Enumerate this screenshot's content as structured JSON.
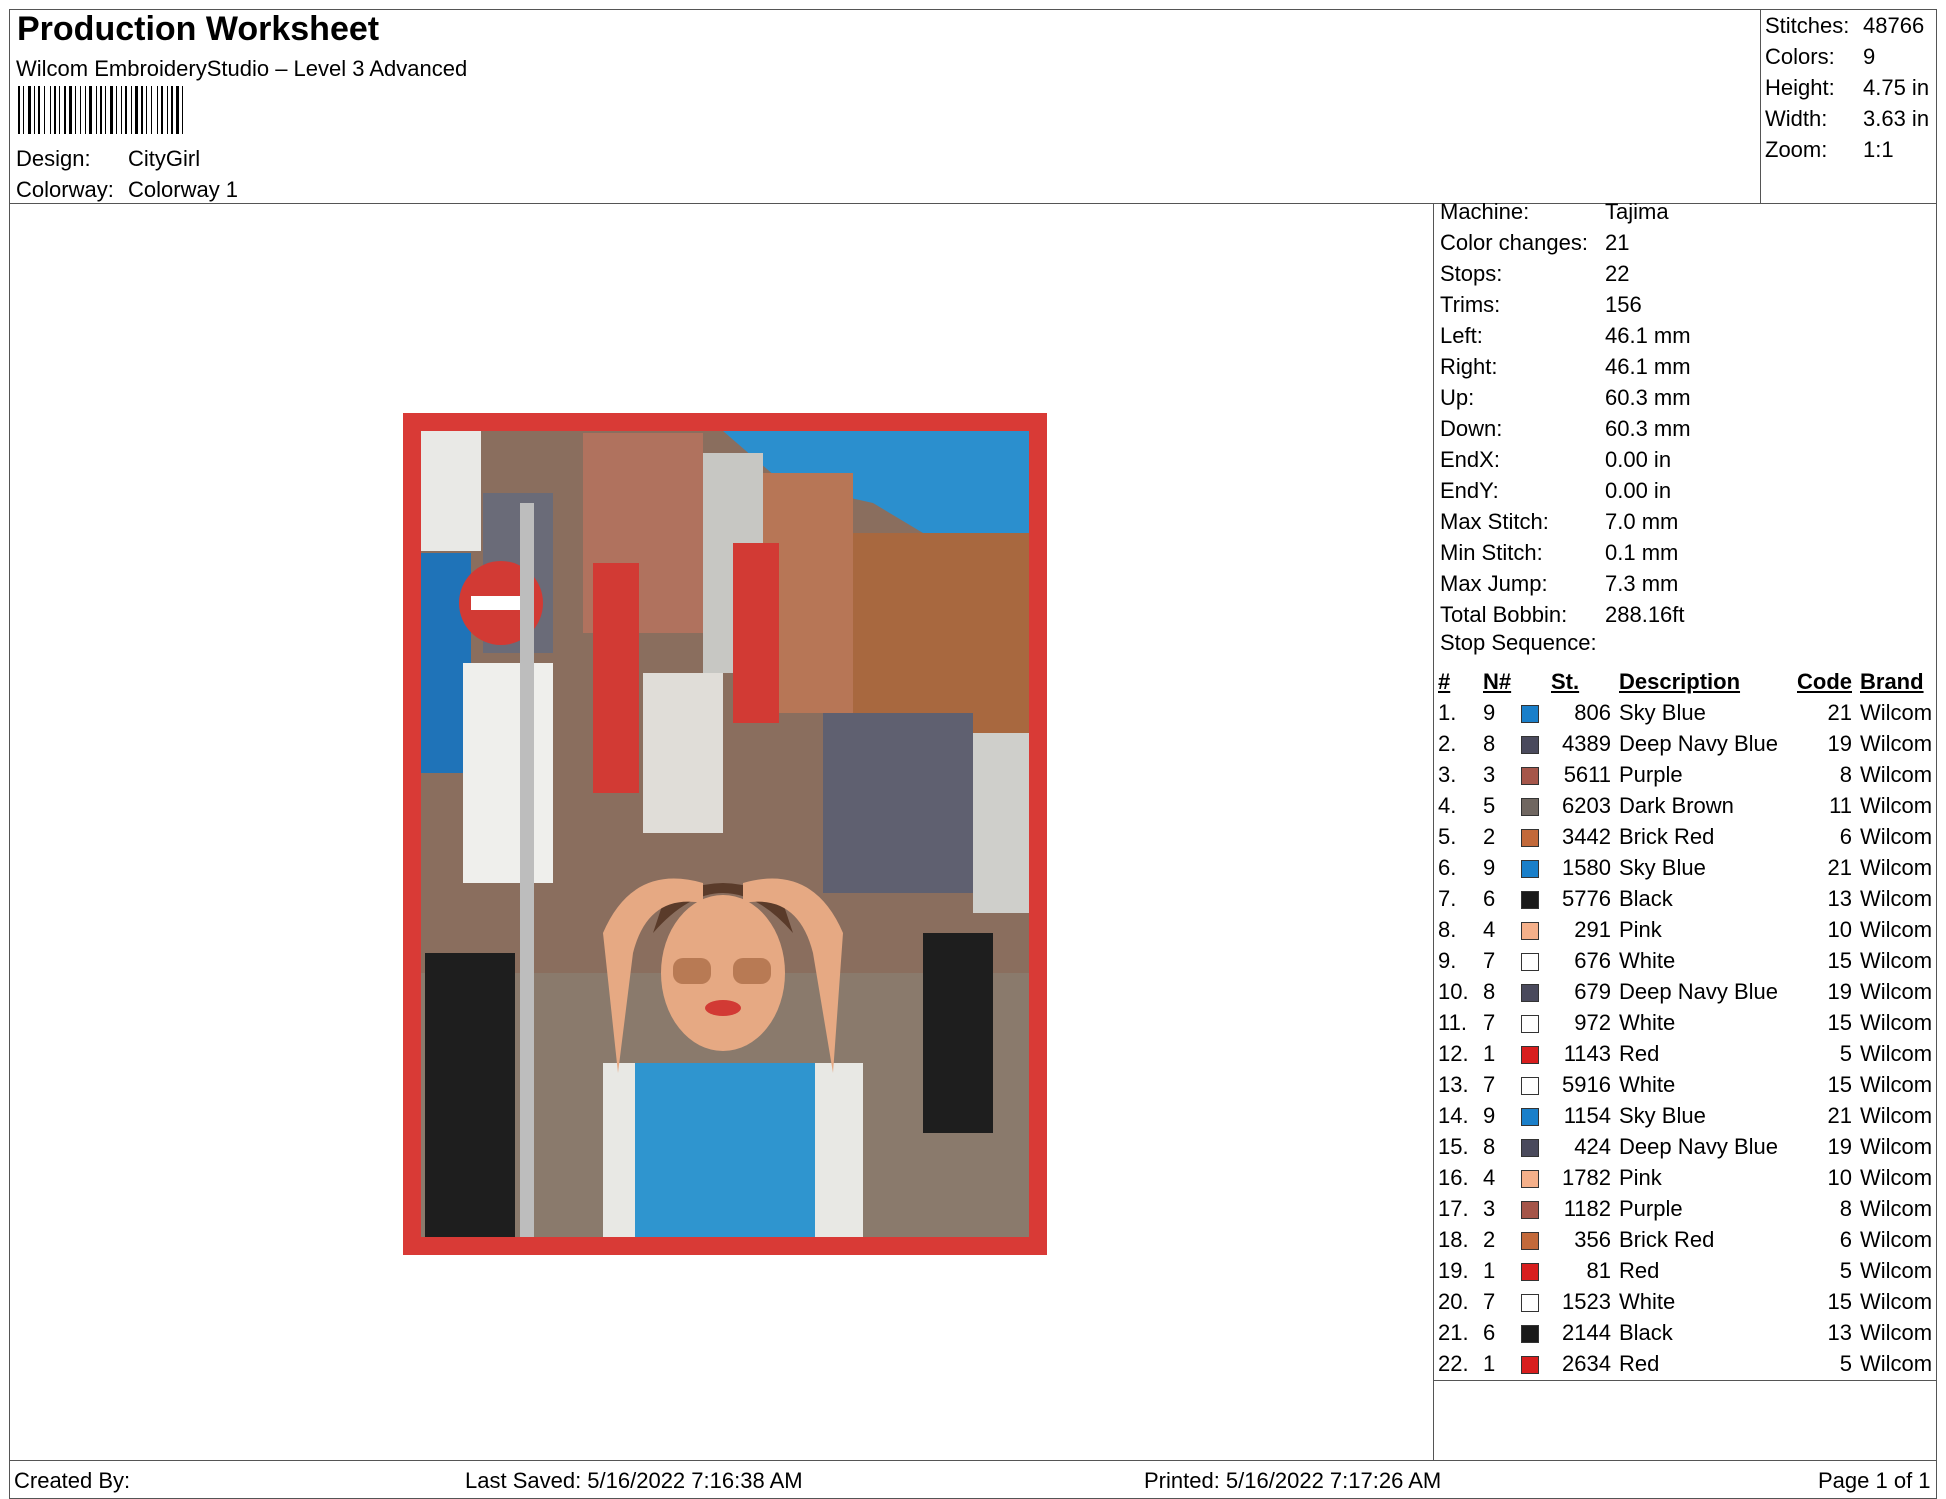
{
  "header": {
    "title": "Production Worksheet",
    "software": "Wilcom EmbroideryStudio – Level 3 Advanced",
    "design_label": "Design:",
    "design_value": "CityGirl",
    "colorway_label": "Colorway:",
    "colorway_value": "Colorway 1"
  },
  "stats": [
    {
      "label": "Stitches:",
      "value": "48766"
    },
    {
      "label": "Colors:",
      "value": "9"
    },
    {
      "label": "Height:",
      "value": "4.75 in"
    },
    {
      "label": "Width:",
      "value": "3.63 in"
    },
    {
      "label": "Zoom:",
      "value": "1:1"
    }
  ],
  "machine": [
    {
      "label": "Machine:",
      "value": "Tajima"
    },
    {
      "label": "Color changes:",
      "value": "21"
    },
    {
      "label": "Stops:",
      "value": "22"
    },
    {
      "label": "Trims:",
      "value": "156"
    },
    {
      "label": "Left:",
      "value": "46.1 mm"
    },
    {
      "label": "Right:",
      "value": "46.1 mm"
    },
    {
      "label": "Up:",
      "value": "60.3 mm"
    },
    {
      "label": "Down:",
      "value": "60.3 mm"
    },
    {
      "label": "EndX:",
      "value": "0.00 in"
    },
    {
      "label": "EndY:",
      "value": "0.00 in"
    },
    {
      "label": "Max Stitch:",
      "value": "7.0 mm"
    },
    {
      "label": "Min Stitch:",
      "value": "0.1 mm"
    },
    {
      "label": "Max Jump:",
      "value": "7.3 mm"
    },
    {
      "label": "Total Bobbin:",
      "value": "288.16ft"
    }
  ],
  "stop_sequence": {
    "title": "Stop Sequence:",
    "columns": {
      "idx": "#",
      "n": "N#",
      "st": "St.",
      "desc": "Description",
      "code": "Code",
      "brand": "Brand"
    },
    "rows": [
      {
        "idx": "1.",
        "n": "9",
        "color": "#1a7fc9",
        "st": "806",
        "desc": "Sky Blue",
        "code": "21",
        "brand": "Wilcom"
      },
      {
        "idx": "2.",
        "n": "8",
        "color": "#4a4a5c",
        "st": "4389",
        "desc": "Deep Navy Blue",
        "code": "19",
        "brand": "Wilcom"
      },
      {
        "idx": "3.",
        "n": "3",
        "color": "#a5564a",
        "st": "5611",
        "desc": "Purple",
        "code": "8",
        "brand": "Wilcom"
      },
      {
        "idx": "4.",
        "n": "5",
        "color": "#6f6660",
        "st": "6203",
        "desc": "Dark Brown",
        "code": "11",
        "brand": "Wilcom"
      },
      {
        "idx": "5.",
        "n": "2",
        "color": "#c2693a",
        "st": "3442",
        "desc": "Brick Red",
        "code": "6",
        "brand": "Wilcom"
      },
      {
        "idx": "6.",
        "n": "9",
        "color": "#1a7fc9",
        "st": "1580",
        "desc": "Sky Blue",
        "code": "21",
        "brand": "Wilcom"
      },
      {
        "idx": "7.",
        "n": "6",
        "color": "#1a1a1a",
        "st": "5776",
        "desc": "Black",
        "code": "13",
        "brand": "Wilcom"
      },
      {
        "idx": "8.",
        "n": "4",
        "color": "#f5b08a",
        "st": "291",
        "desc": "Pink",
        "code": "10",
        "brand": "Wilcom"
      },
      {
        "idx": "9.",
        "n": "7",
        "color": "#ffffff",
        "st": "676",
        "desc": "White",
        "code": "15",
        "brand": "Wilcom"
      },
      {
        "idx": "10.",
        "n": "8",
        "color": "#4a4a5c",
        "st": "679",
        "desc": "Deep Navy Blue",
        "code": "19",
        "brand": "Wilcom"
      },
      {
        "idx": "11.",
        "n": "7",
        "color": "#ffffff",
        "st": "972",
        "desc": "White",
        "code": "15",
        "brand": "Wilcom"
      },
      {
        "idx": "12.",
        "n": "1",
        "color": "#d81e1e",
        "st": "1143",
        "desc": "Red",
        "code": "5",
        "brand": "Wilcom"
      },
      {
        "idx": "13.",
        "n": "7",
        "color": "#ffffff",
        "st": "5916",
        "desc": "White",
        "code": "15",
        "brand": "Wilcom"
      },
      {
        "idx": "14.",
        "n": "9",
        "color": "#1a7fc9",
        "st": "1154",
        "desc": "Sky Blue",
        "code": "21",
        "brand": "Wilcom"
      },
      {
        "idx": "15.",
        "n": "8",
        "color": "#4a4a5c",
        "st": "424",
        "desc": "Deep Navy Blue",
        "code": "19",
        "brand": "Wilcom"
      },
      {
        "idx": "16.",
        "n": "4",
        "color": "#f5b08a",
        "st": "1782",
        "desc": "Pink",
        "code": "10",
        "brand": "Wilcom"
      },
      {
        "idx": "17.",
        "n": "3",
        "color": "#a5564a",
        "st": "1182",
        "desc": "Purple",
        "code": "8",
        "brand": "Wilcom"
      },
      {
        "idx": "18.",
        "n": "2",
        "color": "#c2693a",
        "st": "356",
        "desc": "Brick Red",
        "code": "6",
        "brand": "Wilcom"
      },
      {
        "idx": "19.",
        "n": "1",
        "color": "#d81e1e",
        "st": "81",
        "desc": "Red",
        "code": "5",
        "brand": "Wilcom"
      },
      {
        "idx": "20.",
        "n": "7",
        "color": "#ffffff",
        "st": "1523",
        "desc": "White",
        "code": "15",
        "brand": "Wilcom"
      },
      {
        "idx": "21.",
        "n": "6",
        "color": "#1a1a1a",
        "st": "2144",
        "desc": "Black",
        "code": "13",
        "brand": "Wilcom"
      },
      {
        "idx": "22.",
        "n": "1",
        "color": "#d81e1e",
        "st": "2634",
        "desc": "Red",
        "code": "5",
        "brand": "Wilcom"
      }
    ]
  },
  "footer": {
    "created_by": "Created By:",
    "last_saved": "Last Saved: 5/16/2022 7:16:38 AM",
    "printed": "Printed: 5/16/2022 7:17:26 AM",
    "page": "Page 1 of 1"
  },
  "colors": {
    "border": "#555555",
    "patch_border": "#d93a36"
  }
}
